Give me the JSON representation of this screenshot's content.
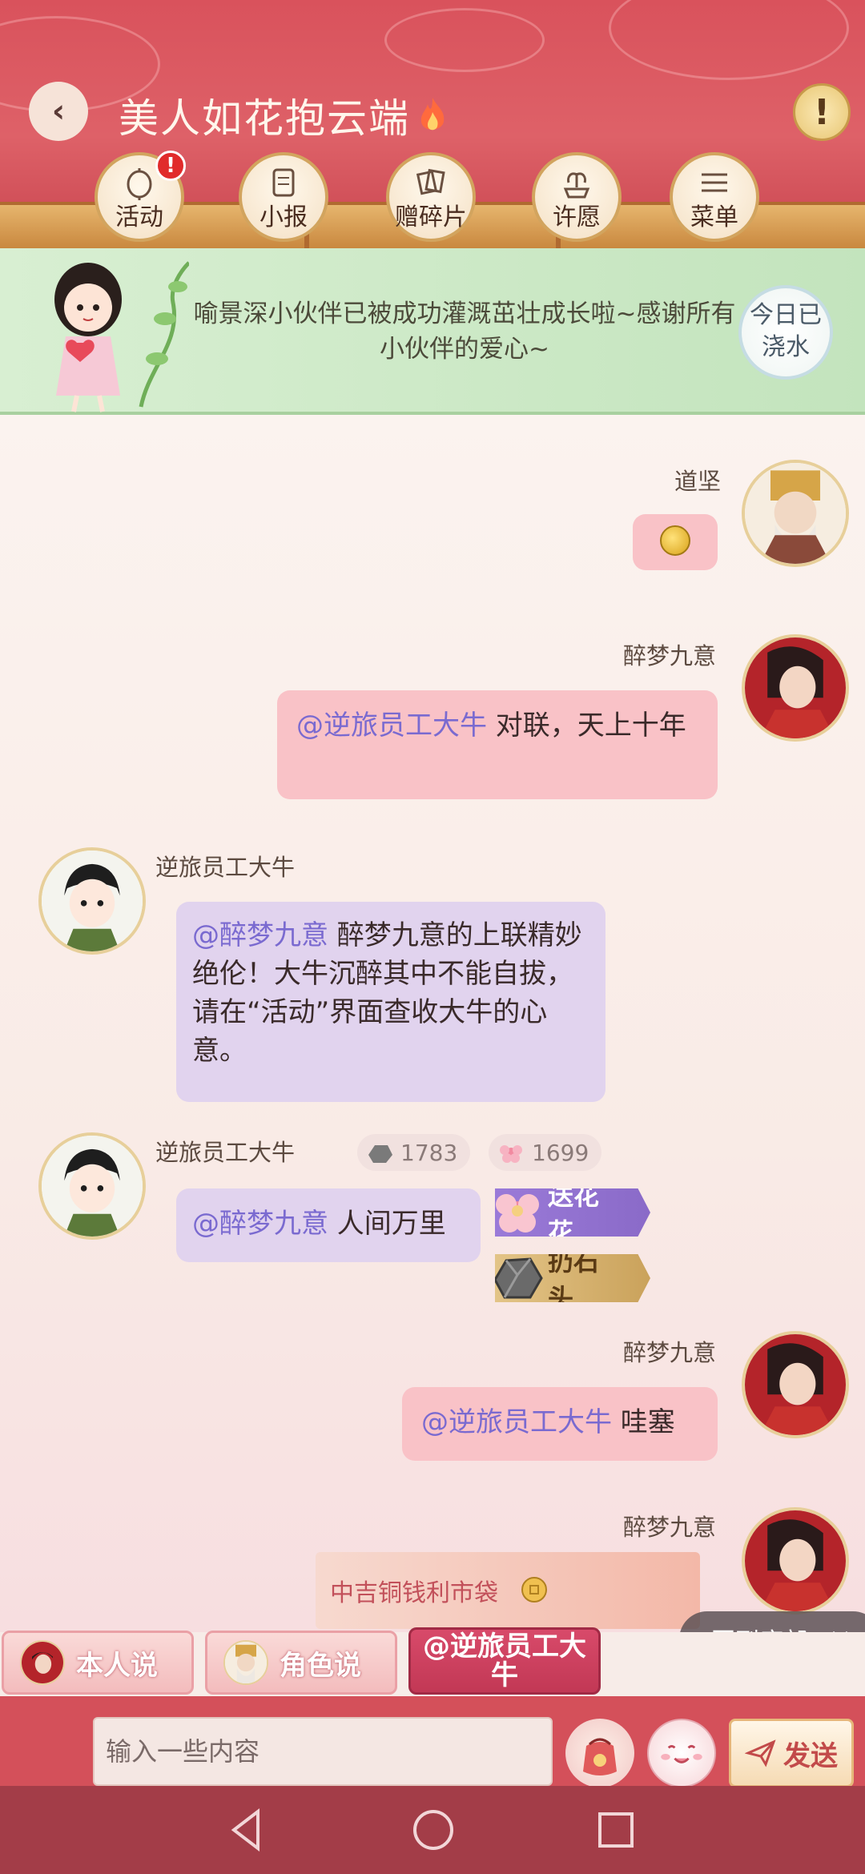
{
  "header": {
    "title": "美人如花抱云端",
    "nav": [
      {
        "label": "活动",
        "icon": "lantern-icon",
        "badge": "!"
      },
      {
        "label": "小报",
        "icon": "scroll-icon"
      },
      {
        "label": "赠碎片",
        "icon": "fragments-icon"
      },
      {
        "label": "许愿",
        "icon": "fountain-icon"
      },
      {
        "label": "菜单",
        "icon": "menu-icon"
      }
    ],
    "warning_label": "!"
  },
  "notice": {
    "text": "喻景深小伙伴已被成功灌溉茁壮成长啦~感谢所有小伙伴的爱心~",
    "watered": "今日已浇水"
  },
  "messages": [
    {
      "user": "道坚",
      "side": "right"
    },
    {
      "user": "醉梦九意",
      "side": "right",
      "at": "@逆旅员工大牛",
      "text": " 对联，天上十年"
    },
    {
      "user": "逆旅员工大牛",
      "side": "left",
      "at": "@醉梦九意",
      "text": " 醉梦九意的上联精妙绝伦！大牛沉醉其中不能自拔，请在“活动”界面查收大牛的心意。"
    },
    {
      "user": "逆旅员工大牛",
      "side": "left",
      "at": "@醉梦九意",
      "text": " 人间万里",
      "stone_count": "1783",
      "flower_count": "1699",
      "flower_action": "送花花",
      "stone_action": "扔石头"
    },
    {
      "user": "醉梦九意",
      "side": "right",
      "at": "@逆旅员工大牛",
      "text": " 哇塞"
    },
    {
      "user": "醉梦九意",
      "side": "right",
      "gift": "中吉铜钱利市袋"
    }
  ],
  "back_to_bottom": "回到底部",
  "speaker_tabs": [
    "本人说",
    "角色说",
    "@逆旅员工大牛"
  ],
  "input": {
    "placeholder": "输入一些内容",
    "send": "发送"
  },
  "colors": {
    "header": "#d9525c",
    "bubble_pink": "#f9c2c7",
    "bubble_purple": "#e1d3ee",
    "mention": "#7a6ad0"
  }
}
